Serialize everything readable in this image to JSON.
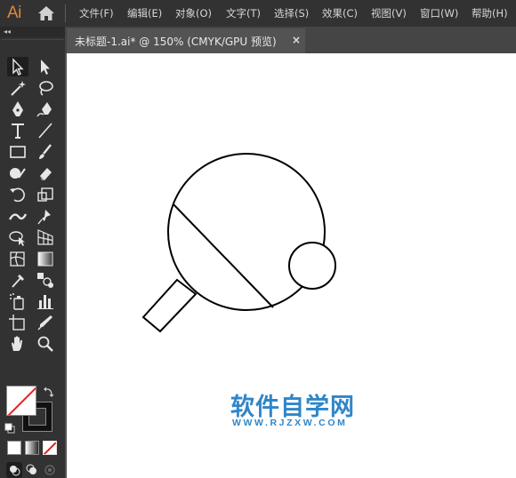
{
  "app": {
    "logo": "Ai"
  },
  "menu": [
    {
      "label": "文件(F)"
    },
    {
      "label": "编辑(E)"
    },
    {
      "label": "对象(O)"
    },
    {
      "label": "文字(T)"
    },
    {
      "label": "选择(S)"
    },
    {
      "label": "效果(C)"
    },
    {
      "label": "视图(V)"
    },
    {
      "label": "窗口(W)"
    },
    {
      "label": "帮助(H)"
    }
  ],
  "panel": {
    "collapse_glyph": "◂◂"
  },
  "tools": [
    {
      "name": "selection-tool-icon",
      "active": true
    },
    {
      "name": "direct-selection-tool-icon"
    },
    {
      "name": "magic-wand-tool-icon"
    },
    {
      "name": "lasso-tool-icon"
    },
    {
      "name": "pen-tool-icon"
    },
    {
      "name": "curvature-tool-icon"
    },
    {
      "name": "type-tool-icon"
    },
    {
      "name": "line-segment-tool-icon"
    },
    {
      "name": "rectangle-tool-icon"
    },
    {
      "name": "paintbrush-tool-icon"
    },
    {
      "name": "shaper-tool-icon"
    },
    {
      "name": "eraser-tool-icon"
    },
    {
      "name": "rotate-tool-icon"
    },
    {
      "name": "scale-tool-icon"
    },
    {
      "name": "width-tool-icon"
    },
    {
      "name": "puppet-warp-tool-icon"
    },
    {
      "name": "shape-builder-tool-icon"
    },
    {
      "name": "perspective-grid-tool-icon"
    },
    {
      "name": "mesh-tool-icon"
    },
    {
      "name": "gradient-tool-icon"
    },
    {
      "name": "eyedropper-tool-icon"
    },
    {
      "name": "blend-tool-icon"
    },
    {
      "name": "symbol-sprayer-tool-icon"
    },
    {
      "name": "column-graph-tool-icon"
    },
    {
      "name": "artboard-tool-icon"
    },
    {
      "name": "slice-tool-icon"
    },
    {
      "name": "hand-tool-icon"
    },
    {
      "name": "zoom-tool-icon"
    }
  ],
  "document_tab": {
    "title": "未标题-1.ai* @ 150% (CMYK/GPU 预览)",
    "close_glyph": "×"
  },
  "watermark": {
    "title": "软件自学网",
    "url": "WWW.RJZXW.COM",
    "color": "#2f86c8"
  },
  "colors": {
    "brand": "#e0873a",
    "ui_dark": "#323232",
    "tab_bg": "#535353",
    "canvas": "#ffffff",
    "stroke": "#000000",
    "none_slash": "#e02020"
  }
}
